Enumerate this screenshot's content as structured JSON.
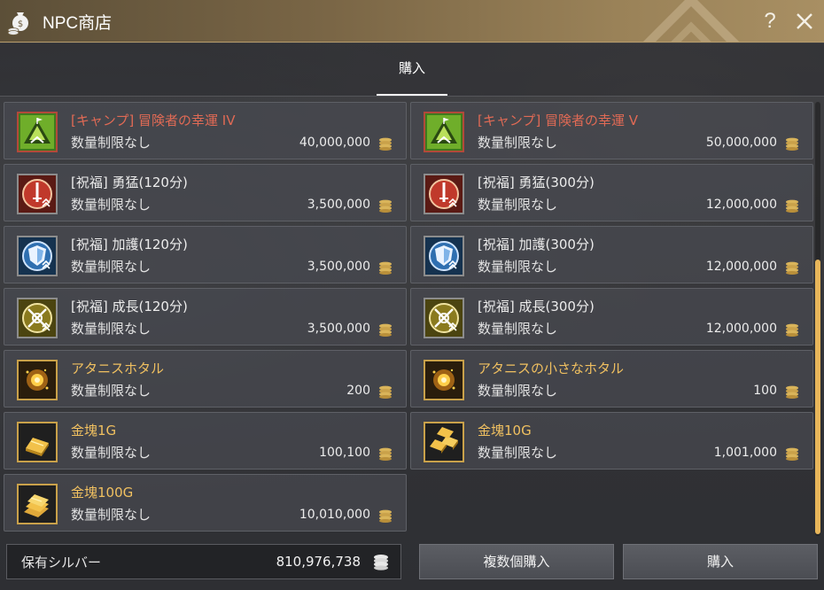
{
  "window": {
    "title": "NPC商店",
    "help_label": "?"
  },
  "tabs": [
    {
      "label": "購入",
      "active": true
    }
  ],
  "items": [
    {
      "name": "[キャンプ] 冒険者の幸運 IV",
      "limit": "数量制限なし",
      "price": "40,000,000",
      "name_color": "red",
      "icon": "camp-tent-icon"
    },
    {
      "name": "[キャンプ] 冒険者の幸運 V",
      "limit": "数量制限なし",
      "price": "50,000,000",
      "name_color": "red",
      "icon": "camp-tent-icon"
    },
    {
      "name": "[祝福] 勇猛(120分)",
      "limit": "数量制限なし",
      "price": "3,500,000",
      "name_color": "white",
      "icon": "sword-buff-icon"
    },
    {
      "name": "[祝福] 勇猛(300分)",
      "limit": "数量制限なし",
      "price": "12,000,000",
      "name_color": "white",
      "icon": "sword-buff-icon"
    },
    {
      "name": "[祝福] 加護(120分)",
      "limit": "数量制限なし",
      "price": "3,500,000",
      "name_color": "white",
      "icon": "shield-buff-icon"
    },
    {
      "name": "[祝福] 加護(300分)",
      "limit": "数量制限なし",
      "price": "12,000,000",
      "name_color": "white",
      "icon": "shield-buff-icon"
    },
    {
      "name": "[祝福] 成長(120分)",
      "limit": "数量制限なし",
      "price": "3,500,000",
      "name_color": "white",
      "icon": "growth-buff-icon"
    },
    {
      "name": "[祝福] 成長(300分)",
      "limit": "数量制限なし",
      "price": "12,000,000",
      "name_color": "white",
      "icon": "growth-buff-icon"
    },
    {
      "name": "アタニスホタル",
      "limit": "数量制限なし",
      "price": "200",
      "name_color": "gold",
      "icon": "firefly-icon"
    },
    {
      "name": "アタニスの小さなホタル",
      "limit": "数量制限なし",
      "price": "100",
      "name_color": "gold",
      "icon": "firefly-icon"
    },
    {
      "name": "金塊1G",
      "limit": "数量制限なし",
      "price": "100,100",
      "name_color": "gold",
      "icon": "gold-bar-icon"
    },
    {
      "name": "金塊10G",
      "limit": "数量制限なし",
      "price": "1,001,000",
      "name_color": "gold",
      "icon": "gold-bars-icon"
    },
    {
      "name": "金塊100G",
      "limit": "数量制限なし",
      "price": "10,010,000",
      "name_color": "gold",
      "icon": "gold-stack-icon"
    }
  ],
  "footer": {
    "silver_label": "保有シルバー",
    "silver_value": "810,976,738",
    "bulk_buy_label": "複数個購入",
    "buy_label": "購入"
  },
  "colors": {
    "name_red": "#e06a55",
    "name_gold": "#f0c060",
    "scroll_thumb": "#e8b65a",
    "titlebar": "#9a8258"
  }
}
